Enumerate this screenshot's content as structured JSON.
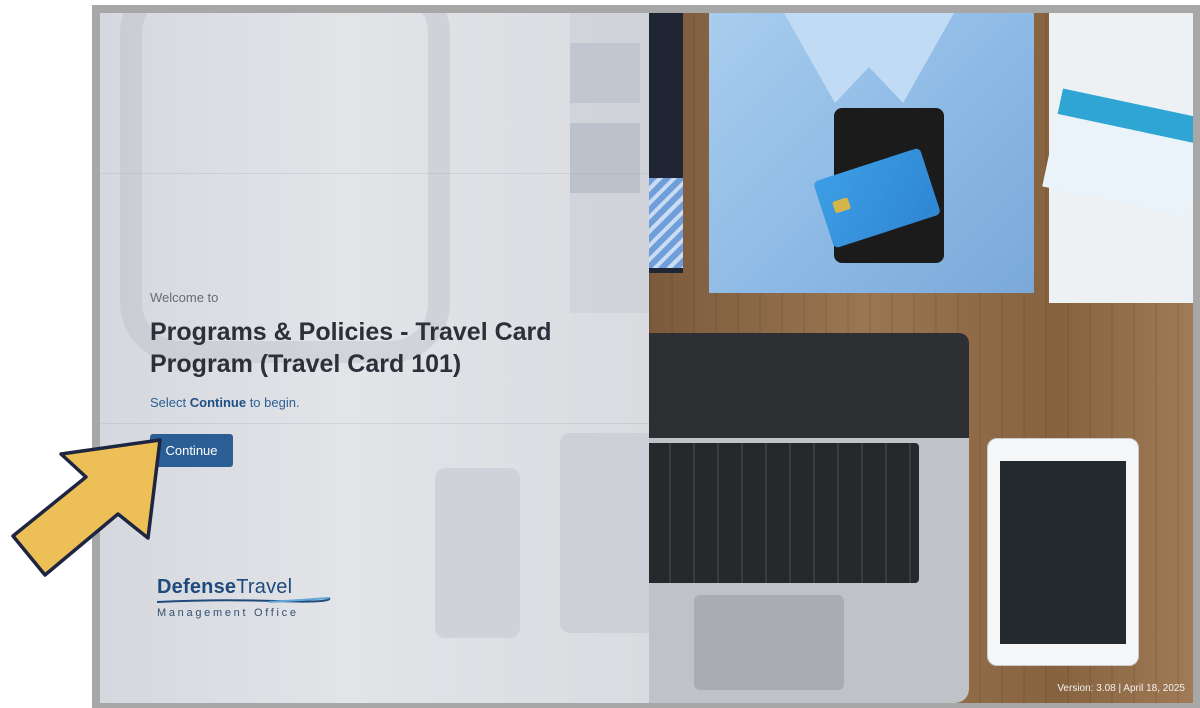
{
  "welcome_text": "Welcome to",
  "course_title": "Programs & Policies - Travel Card Program (Travel Card 101)",
  "hint": {
    "prefix": "Select ",
    "emphasis": "Continue",
    "suffix": " to begin."
  },
  "continue_label": "Continue",
  "logo": {
    "word_bold": "Defense",
    "word_regular": "Travel",
    "subline": "Management Office"
  },
  "version_text": "Version: 3.08 | April 18, 2025",
  "icons": {
    "pointer": "pointer-arrow-icon",
    "logo_swoosh": "logo-swoosh-icon"
  },
  "colors": {
    "button": "#2b5e95",
    "title": "#2b3039",
    "link": "#2d5f95",
    "arrow_fill": "#ecbf57",
    "arrow_stroke": "#1d2540",
    "frame": "#a7a7a7"
  }
}
